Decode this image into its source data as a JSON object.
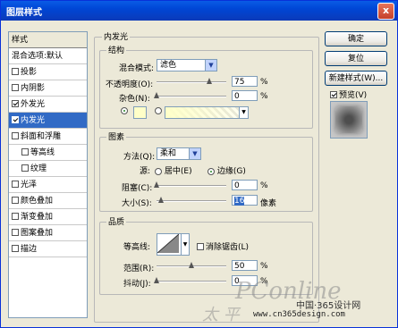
{
  "window": {
    "title": "图层样式",
    "close_glyph": "x"
  },
  "style_list": {
    "header": "样式",
    "blend_default": "混合选项:默认",
    "items": [
      {
        "label": "投影",
        "checked": false
      },
      {
        "label": "内阴影",
        "checked": false
      },
      {
        "label": "外发光",
        "checked": true
      },
      {
        "label": "内发光",
        "checked": true,
        "selected": true
      },
      {
        "label": "斜面和浮雕",
        "checked": false
      },
      {
        "label": "等高线",
        "checked": false,
        "sub": true
      },
      {
        "label": "纹理",
        "checked": false,
        "sub": true
      },
      {
        "label": "光泽",
        "checked": false
      },
      {
        "label": "颜色叠加",
        "checked": false
      },
      {
        "label": "渐变叠加",
        "checked": false
      },
      {
        "label": "图案叠加",
        "checked": false
      },
      {
        "label": "描边",
        "checked": false
      }
    ]
  },
  "panel": {
    "title": "内发光",
    "structure": {
      "title": "结构",
      "blend_mode_label": "混合模式:",
      "blend_mode_value": "滤色",
      "opacity_label": "不透明度(O):",
      "opacity_value": "75",
      "opacity_unit": "%",
      "opacity_level": 0.75,
      "noise_label": "杂色(N):",
      "noise_value": "0",
      "noise_unit": "%",
      "noise_level": 0,
      "swatch_color": "#ffffc8"
    },
    "elements": {
      "title": "图素",
      "method_label": "方法(Q):",
      "method_value": "柔和",
      "source_label": "源:",
      "source_center": "居中(E)",
      "source_edge": "边缘(G)",
      "choke_label": "阻塞(C):",
      "choke_value": "0",
      "choke_unit": "%",
      "choke_level": 0,
      "size_label": "大小(S):",
      "size_value": "16",
      "size_unit": "像素",
      "size_level": 0.064
    },
    "quality": {
      "title": "品质",
      "contour_label": "等高线:",
      "anti_alias_label": "消除锯齿(L)",
      "range_label": "范围(R):",
      "range_value": "50",
      "range_unit": "%",
      "range_level": 0.5,
      "jitter_label": "抖动(J):",
      "jitter_value": "0",
      "jitter_unit": "%",
      "jitter_level": 0
    }
  },
  "buttons": {
    "ok": "确定",
    "reset": "复位",
    "new_style": "新建样式(W)...",
    "preview_label": "预览(V)"
  },
  "watermark": {
    "brand": "PConline",
    "site_text": "中国·365设计网",
    "url": "www.cn365design.com",
    "chinese": "太 平"
  }
}
